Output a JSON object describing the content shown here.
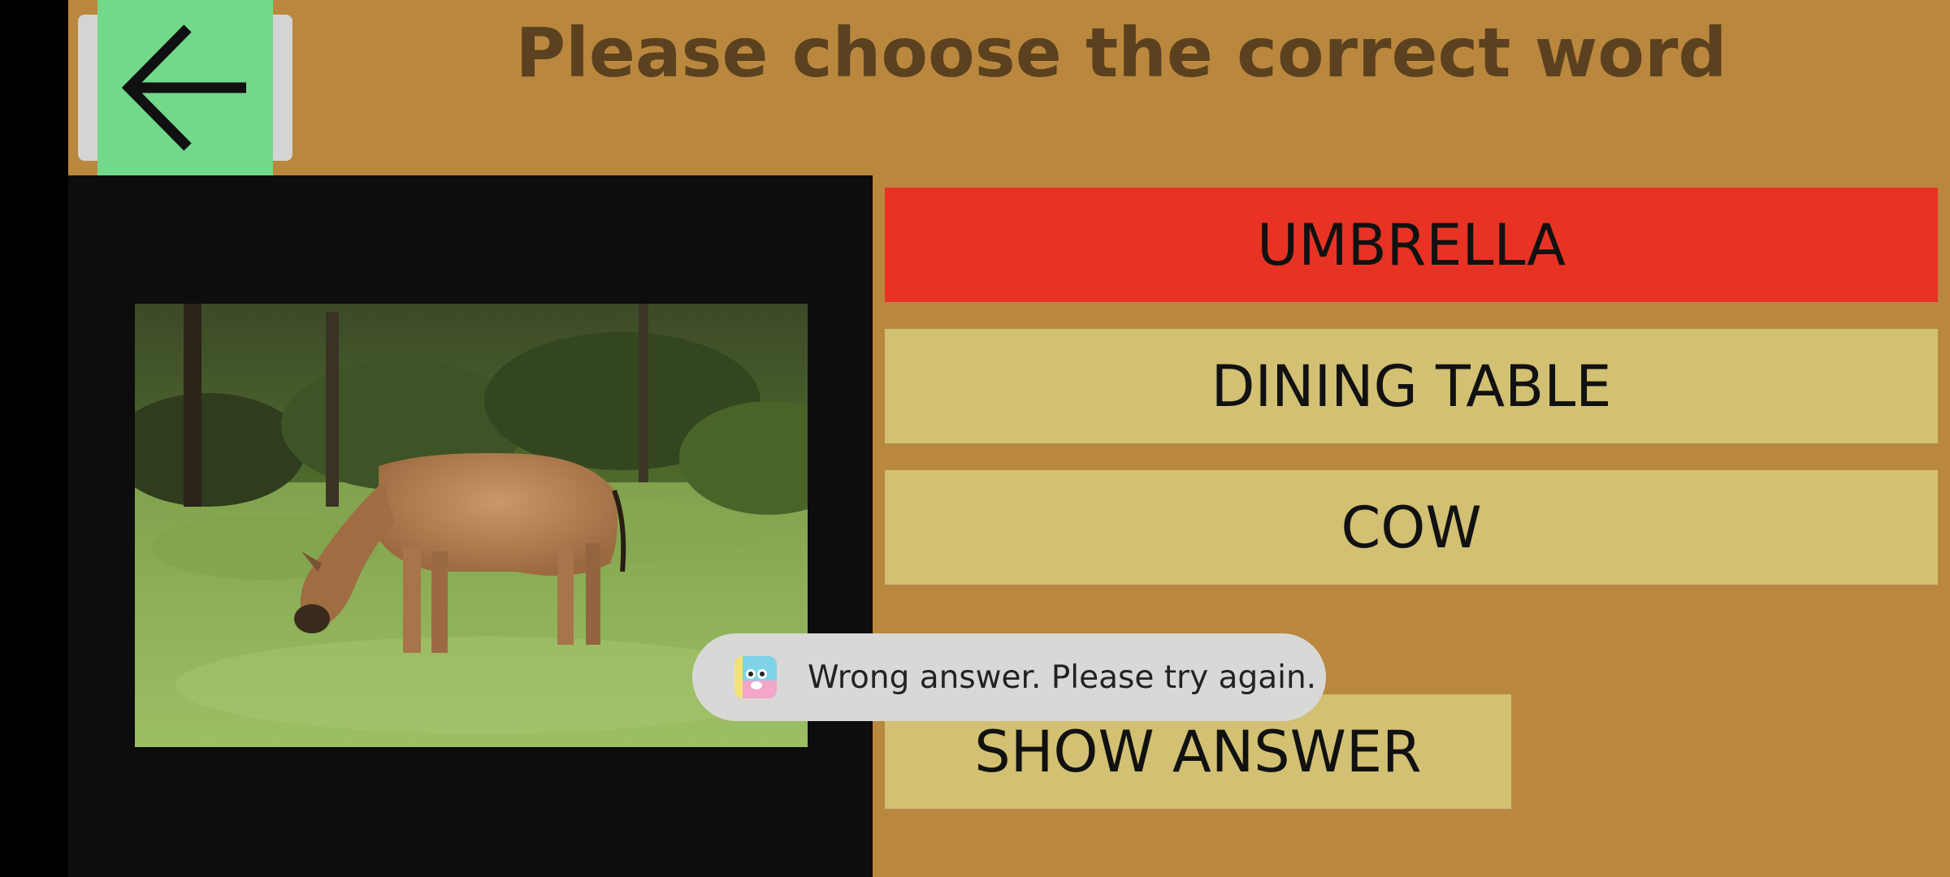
{
  "header": {
    "title": "Please choose the correct word"
  },
  "back_button": {
    "icon": "arrow-left-icon"
  },
  "picture": {
    "subject_icon": "cow-photo"
  },
  "options": [
    {
      "label": "UMBRELLA",
      "state": "wrong",
      "color": "#e83324"
    },
    {
      "label": "DINING TABLE",
      "state": "default",
      "color": "#d2c073"
    },
    {
      "label": "COW",
      "state": "default",
      "color": "#d2c073"
    }
  ],
  "show_answer": {
    "label": "SHOW ANSWER",
    "color": "#d2c073"
  },
  "toast": {
    "message": "Wrong answer. Please try again.",
    "icon": "app-face-icon"
  },
  "colors": {
    "background": "#b9883e",
    "back_button": "#72d88a",
    "title_text": "#5b411f",
    "image_panel": "#0d0d0d"
  }
}
